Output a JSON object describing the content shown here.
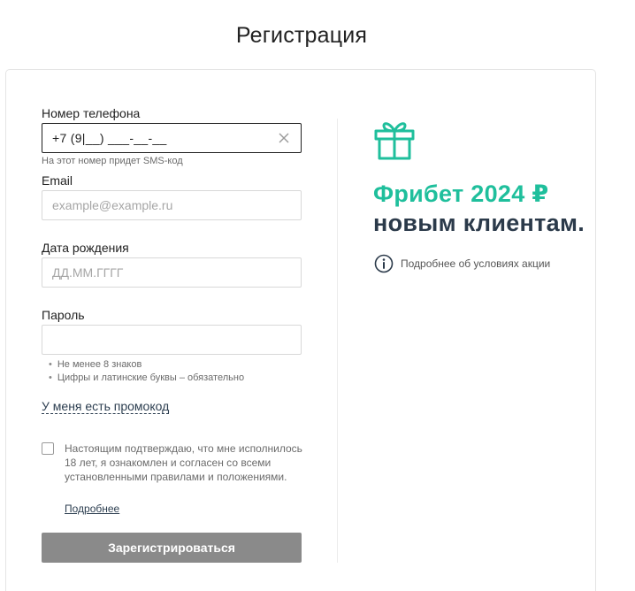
{
  "page": {
    "title": "Регистрация"
  },
  "form": {
    "phone": {
      "label": "Номер телефона",
      "value": "+7 (9|__) ___-__-__",
      "hint": "На этот номер придет SMS-код"
    },
    "email": {
      "label": "Email",
      "placeholder": "example@example.ru"
    },
    "birthdate": {
      "label": "Дата рождения",
      "placeholder": "ДД.ММ.ГГГГ"
    },
    "password": {
      "label": "Пароль",
      "placeholder": "",
      "rules": [
        "Не менее 8 знаков",
        "Цифры и латинские буквы – обязательно"
      ]
    },
    "promo_link": "У меня есть промокод",
    "consent": {
      "checked": false,
      "text": "Настоящим подтверждаю, что мне исполнилось 18 лет, я ознакомлен и согласен со всеми установленными правилами и положениями.",
      "more_link": "Подробнее"
    },
    "submit_label": "Зарегистрироваться"
  },
  "promo": {
    "line1": "Фрибет 2024 ₽",
    "line2": "новым клиентам.",
    "info_text": "Подробнее об условиях акции"
  },
  "colors": {
    "accent": "#1fbf9c",
    "dark_text": "#2b3a4a",
    "button_disabled": "#8a8a8a"
  },
  "icons": {
    "clear": "close-icon",
    "gift": "gift-icon",
    "info": "info-icon"
  }
}
